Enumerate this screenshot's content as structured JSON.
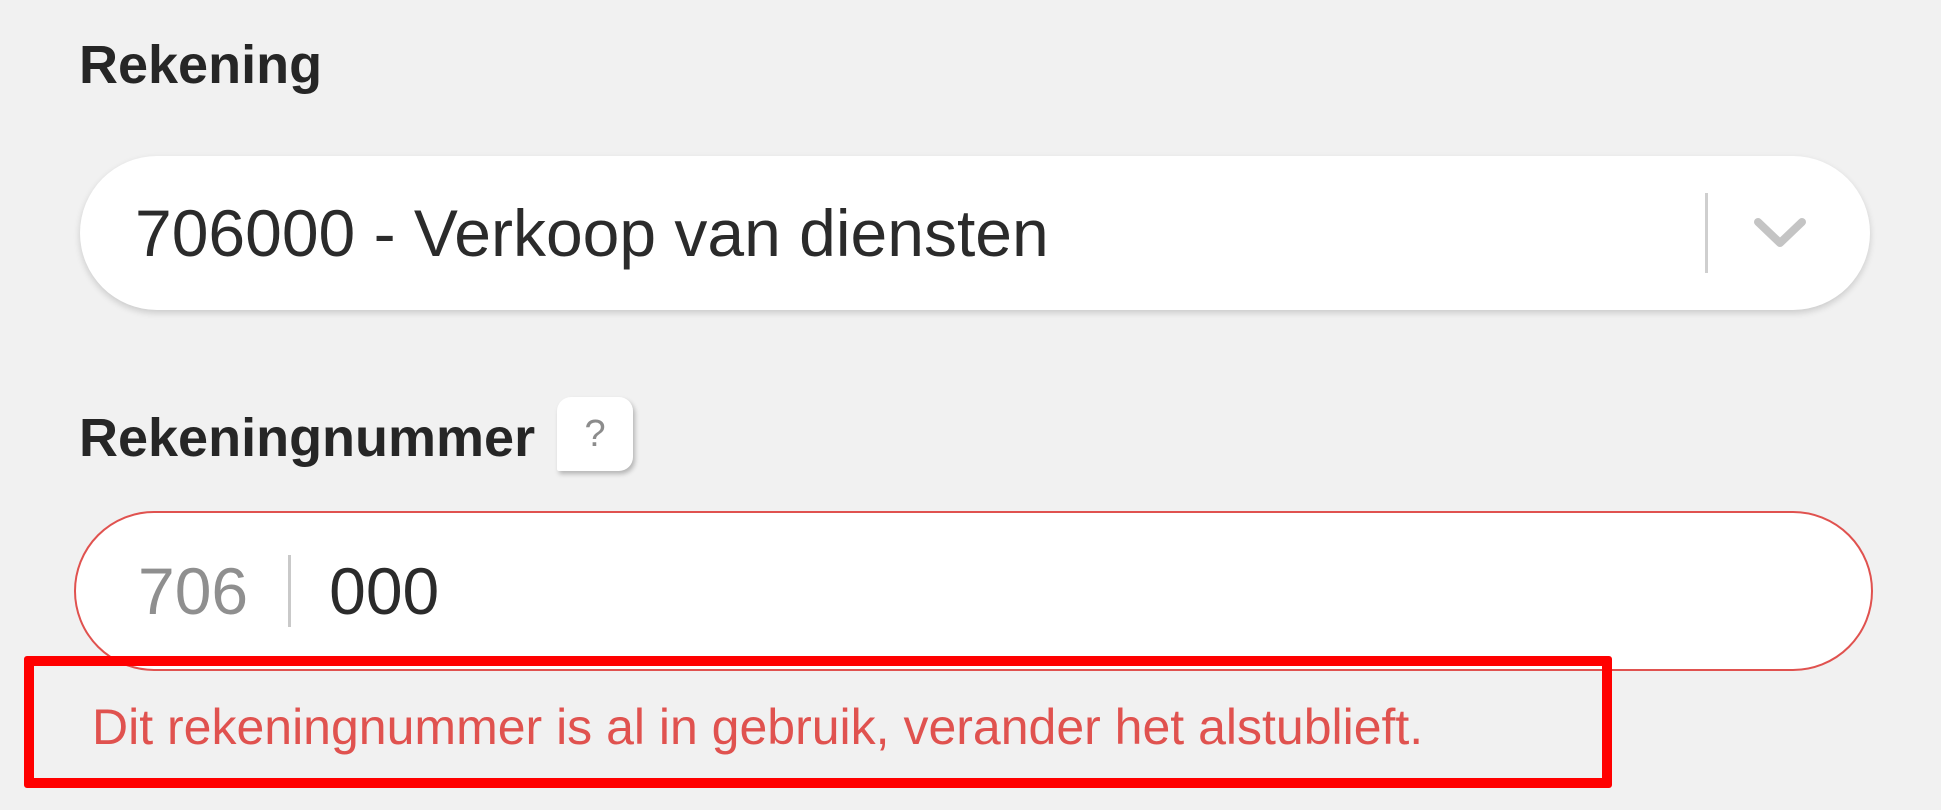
{
  "account": {
    "label": "Rekening",
    "selected_value": "706000 - Verkoop van diensten",
    "dropdown_icon": "chevron-down-icon"
  },
  "account_number": {
    "label": "Rekeningnummer",
    "help_glyph": "?",
    "help_icon": "help-icon",
    "prefix": "706",
    "value": "000",
    "error_message": "Dit rekeningnummer is al in gebruik, verander het alstublieft."
  },
  "colors": {
    "background": "#f1f1f1",
    "error": "#e0524f",
    "highlight": "#ff0000",
    "text": "#262626"
  }
}
